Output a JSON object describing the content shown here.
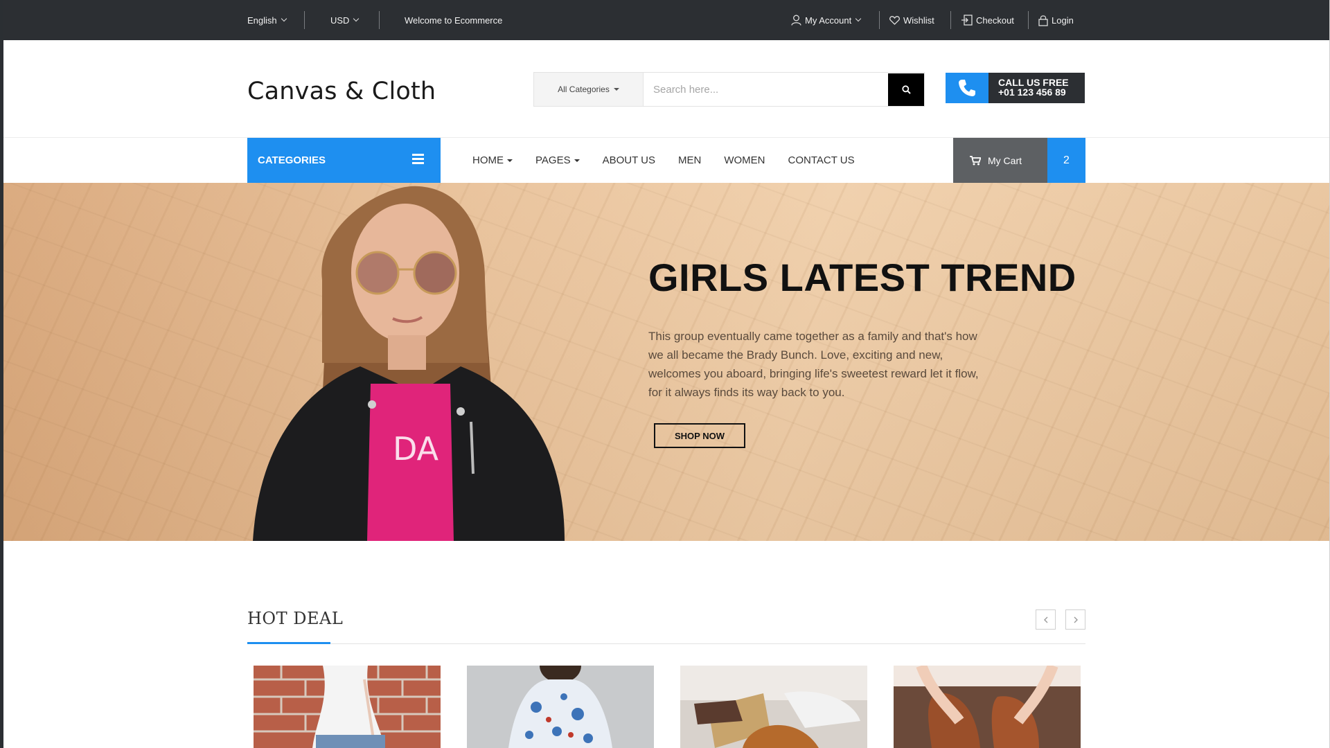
{
  "topbar": {
    "language": "English",
    "currency": "USD",
    "welcome": "Welcome to Ecommerce",
    "my_account": "My Account",
    "wishlist": "Wishlist",
    "checkout": "Checkout",
    "login": "Login"
  },
  "header": {
    "logo": "Canvas & Cloth",
    "category_select": "All Categories",
    "search_placeholder": "Search here...",
    "call_line1": "CALL US FREE",
    "call_line2": "+01 123 456 89"
  },
  "nav": {
    "categories": "CATEGORIES",
    "items": [
      {
        "label": "HOME",
        "dropdown": true
      },
      {
        "label": "PAGES",
        "dropdown": true
      },
      {
        "label": "ABOUT US",
        "dropdown": false
      },
      {
        "label": "MEN",
        "dropdown": false
      },
      {
        "label": "WOMEN",
        "dropdown": false
      },
      {
        "label": "CONTACT US",
        "dropdown": false
      }
    ],
    "cart_label": "My Cart",
    "cart_count": "2"
  },
  "hero": {
    "title": "GIRLS LATEST TREND",
    "text": "This group eventually came together as a family and that's how we all became the Brady Bunch. Love, exciting and new, welcomes you aboard, bringing life's sweetest reward let it flow, for it always finds its way back to you.",
    "button": "SHOP NOW"
  },
  "hot_deal": {
    "title": "HOT DEAL",
    "prev_icon": "chevron-left-icon",
    "next_icon": "chevron-right-icon"
  },
  "colors": {
    "accent": "#1e8ff0",
    "topbar": "#2c2f33",
    "cart": "#5d6063"
  }
}
